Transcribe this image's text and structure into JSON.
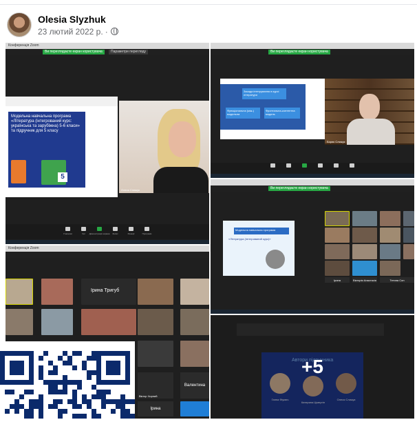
{
  "post": {
    "author": "Olesia Slyzhuk",
    "date": "23 лютий 2022 р.",
    "separator": "·",
    "privacy_icon": "globe-icon"
  },
  "collage": {
    "more_count": "+5",
    "screen1": {
      "tab": "Конференція Zoom",
      "pill_green": "Ви переглядаєте екран користувача",
      "pill_dark": "Параметри перегляду",
      "slide_text": "Модельна навчальна програма «Література (інтегрований курс: українська та зарубіжна) 5-6 класи» та підручник для 5 класу",
      "presenter": "Олеся Слижук",
      "grade_badge": "5",
      "tools": [
        "Учасники",
        "Чат",
        "Демонстрація екрана",
        "Запис",
        "Реакції",
        "Програми"
      ]
    },
    "screen2": {
      "pill_green": "Ви переглядаєте екран користувача",
      "box_title": "Засади інтегрування в курсі літератури",
      "box_left": "Функціональна (між-) модельна",
      "box_right": "Фронтальна-контентна модель",
      "presenter": "Борис Слижук"
    },
    "screen3": {
      "pill_green": "Ви переглядаєте екран користувача",
      "slide_title": "Модельна навчальна програма",
      "slide_sub": "«Література (інтегрований курс)»",
      "tile_names": [
        "Ірина",
        "Вікторія Анастасія",
        "Тетяна Сон"
      ]
    },
    "screen4": {
      "tab": "Конференція Zoom",
      "tile_names": [
        "Ірина Тригуб",
        "Валентина",
        "Ірина",
        "Віктор Чорний"
      ]
    },
    "screen5": {
      "slide_title": "Автори підручника",
      "authors": [
        "Ганна Фіумич",
        "Катерина Цімергін",
        "Олеся Слижук"
      ]
    }
  },
  "colors": {
    "zoom_green": "#27a844",
    "slide_blue": "#203a8f",
    "meta_gray": "#65676b"
  }
}
